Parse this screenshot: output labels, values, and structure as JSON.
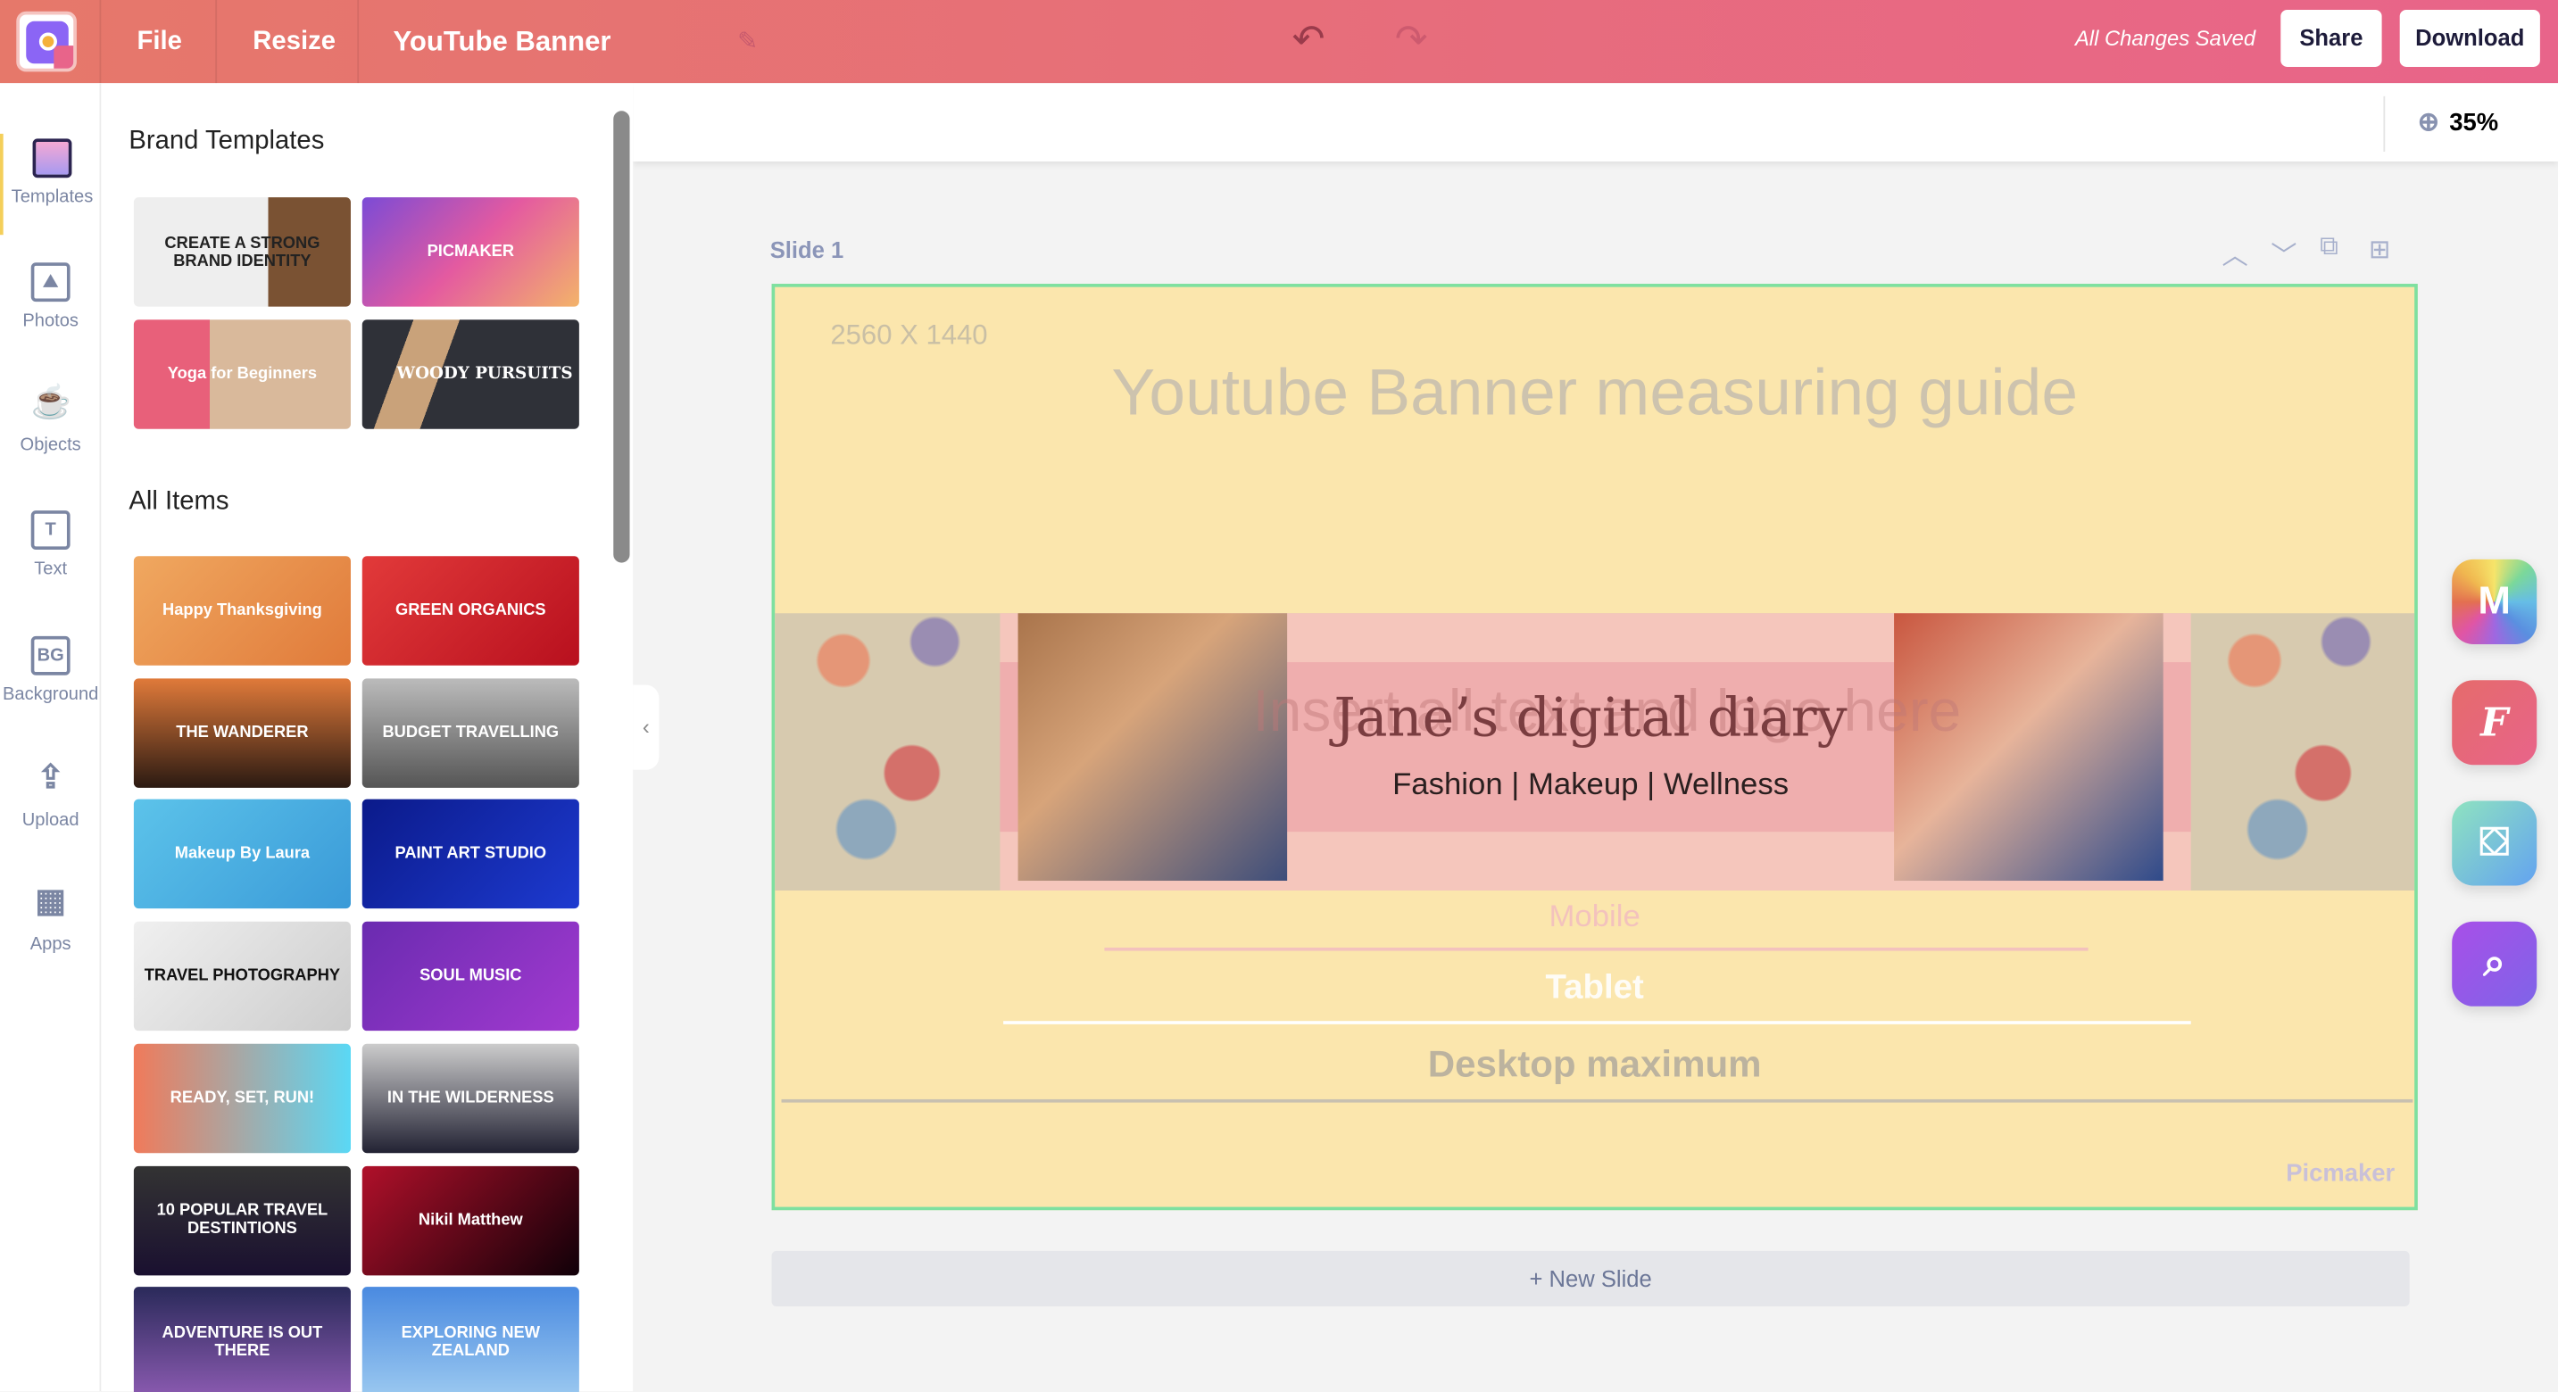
{
  "topbar": {
    "file": "File",
    "resize": "Resize",
    "title": "YouTube Banner",
    "status": "All Changes Saved",
    "share": "Share",
    "download": "Download"
  },
  "zoom": {
    "level": "35%"
  },
  "leftnav": [
    {
      "label": "Templates",
      "icon": "BG-template"
    },
    {
      "label": "Photos"
    },
    {
      "label": "Objects"
    },
    {
      "label": "Text",
      "glyph": "T"
    },
    {
      "label": "Background",
      "glyph": "BG"
    },
    {
      "label": "Upload"
    },
    {
      "label": "Apps"
    }
  ],
  "panel": {
    "brand_heading": "Brand Templates",
    "brand": [
      {
        "title": "CREATE A STRONG BRAND IDENTITY"
      },
      {
        "title": "PICMAKER"
      },
      {
        "title": "Yoga for Beginners"
      },
      {
        "title": "WOODY PURSUITS"
      }
    ],
    "all_heading": "All Items",
    "items": [
      {
        "title": "Happy Thanksgiving"
      },
      {
        "title": "GREEN ORGANICS"
      },
      {
        "title": "THE WANDERER"
      },
      {
        "title": "BUDGET TRAVELLING"
      },
      {
        "title": "Makeup By Laura"
      },
      {
        "title": "PAINT ART STUDIO"
      },
      {
        "title": "TRAVEL PHOTOGRAPHY"
      },
      {
        "title": "SOUL MUSIC"
      },
      {
        "title": "READY, SET, RUN!"
      },
      {
        "title": "IN THE WILDERNESS"
      },
      {
        "title": "10 POPULAR TRAVEL DESTINTIONS"
      },
      {
        "title": "Nikil Matthew"
      },
      {
        "title": "ADVENTURE IS OUT THERE"
      },
      {
        "title": "EXPLORING NEW ZEALAND"
      }
    ]
  },
  "slide": {
    "label": "Slide 1",
    "dimensions": "2560 X 1440",
    "guide_title": "Youtube Banner measuring guide",
    "insert_text": "Insert all text and logo here",
    "name": "Jane’s digital diary",
    "tagline": "Fashion | Makeup | Wellness",
    "mobile": "Mobile",
    "tablet": "Tablet",
    "desktop": "Desktop maximum",
    "watermark": "Picmaker"
  },
  "new_slide": "+ New Slide",
  "apps": [
    "rainbow-m-app",
    "font-app",
    "paint-bucket-app",
    "image-search-app"
  ],
  "colors": {
    "topbar_start": "#e6786a",
    "topbar_end": "#e8648a",
    "slide_border": "#7ee0a0",
    "slide_bg": "#fbe6ad"
  }
}
